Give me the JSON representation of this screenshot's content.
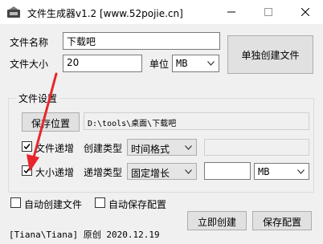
{
  "window": {
    "title": "文件生成器v1.2 [www.52pojie.cn]"
  },
  "file_name": {
    "label": "文件名称",
    "value": "下载吧"
  },
  "file_size": {
    "label": "文件大小",
    "value": "20"
  },
  "unit": {
    "label": "单位",
    "selected": "MB"
  },
  "create_single_button": "单独创建文件",
  "settings": {
    "group_label": "文件设置",
    "save_location_button": "保存位置",
    "save_path": "D:\\tools\\桌面\\下载吧"
  },
  "file_increment": {
    "label": "文件递增",
    "checked": true,
    "type_label": "创建类型",
    "type_selected": "时间格式"
  },
  "size_increment": {
    "label": "大小递增",
    "checked": true,
    "type_label": "递增类型",
    "type_selected": "固定增长",
    "amount_value": "",
    "unit_selected": "MB"
  },
  "auto_create": {
    "label": "自动创建文件",
    "checked": false
  },
  "auto_save": {
    "label": "自动保存配置",
    "checked": false
  },
  "credit": "[Tiana\\Tiana] 原创 2020.12.19",
  "create_now_button": "立即创建",
  "save_config_button": "保存配置",
  "annotation": {
    "arrow_color": "#e8262a"
  }
}
